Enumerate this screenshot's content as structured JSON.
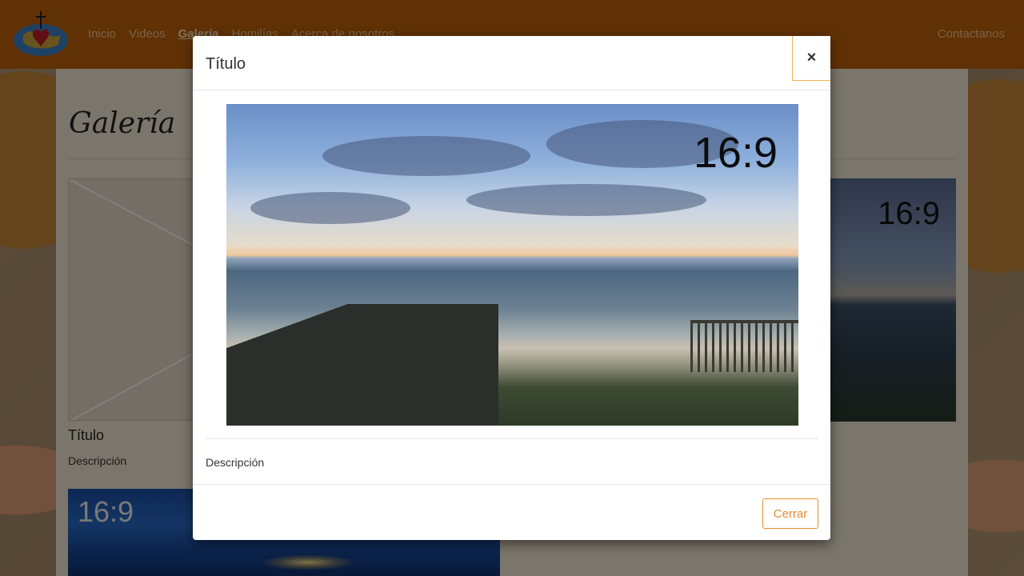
{
  "navbar": {
    "links": [
      "Inicio",
      "Videos",
      "Galería",
      "Homilías",
      "Acerca de nosotros"
    ],
    "contact": "Contactanos"
  },
  "page": {
    "title": "Galería",
    "card": {
      "title": "Título",
      "description": "Descripción"
    },
    "thumb_ratio_label": "16:9"
  },
  "modal": {
    "title": "Título",
    "close_symbol": "×",
    "image_label": "16:9",
    "description": "Descripción",
    "close_button": "Cerrar"
  },
  "colors": {
    "navbar": "#c0620a",
    "accent": "#e98b2c"
  },
  "icons": {
    "logo": "globe-heart-cross-logo",
    "close": "close-icon"
  }
}
